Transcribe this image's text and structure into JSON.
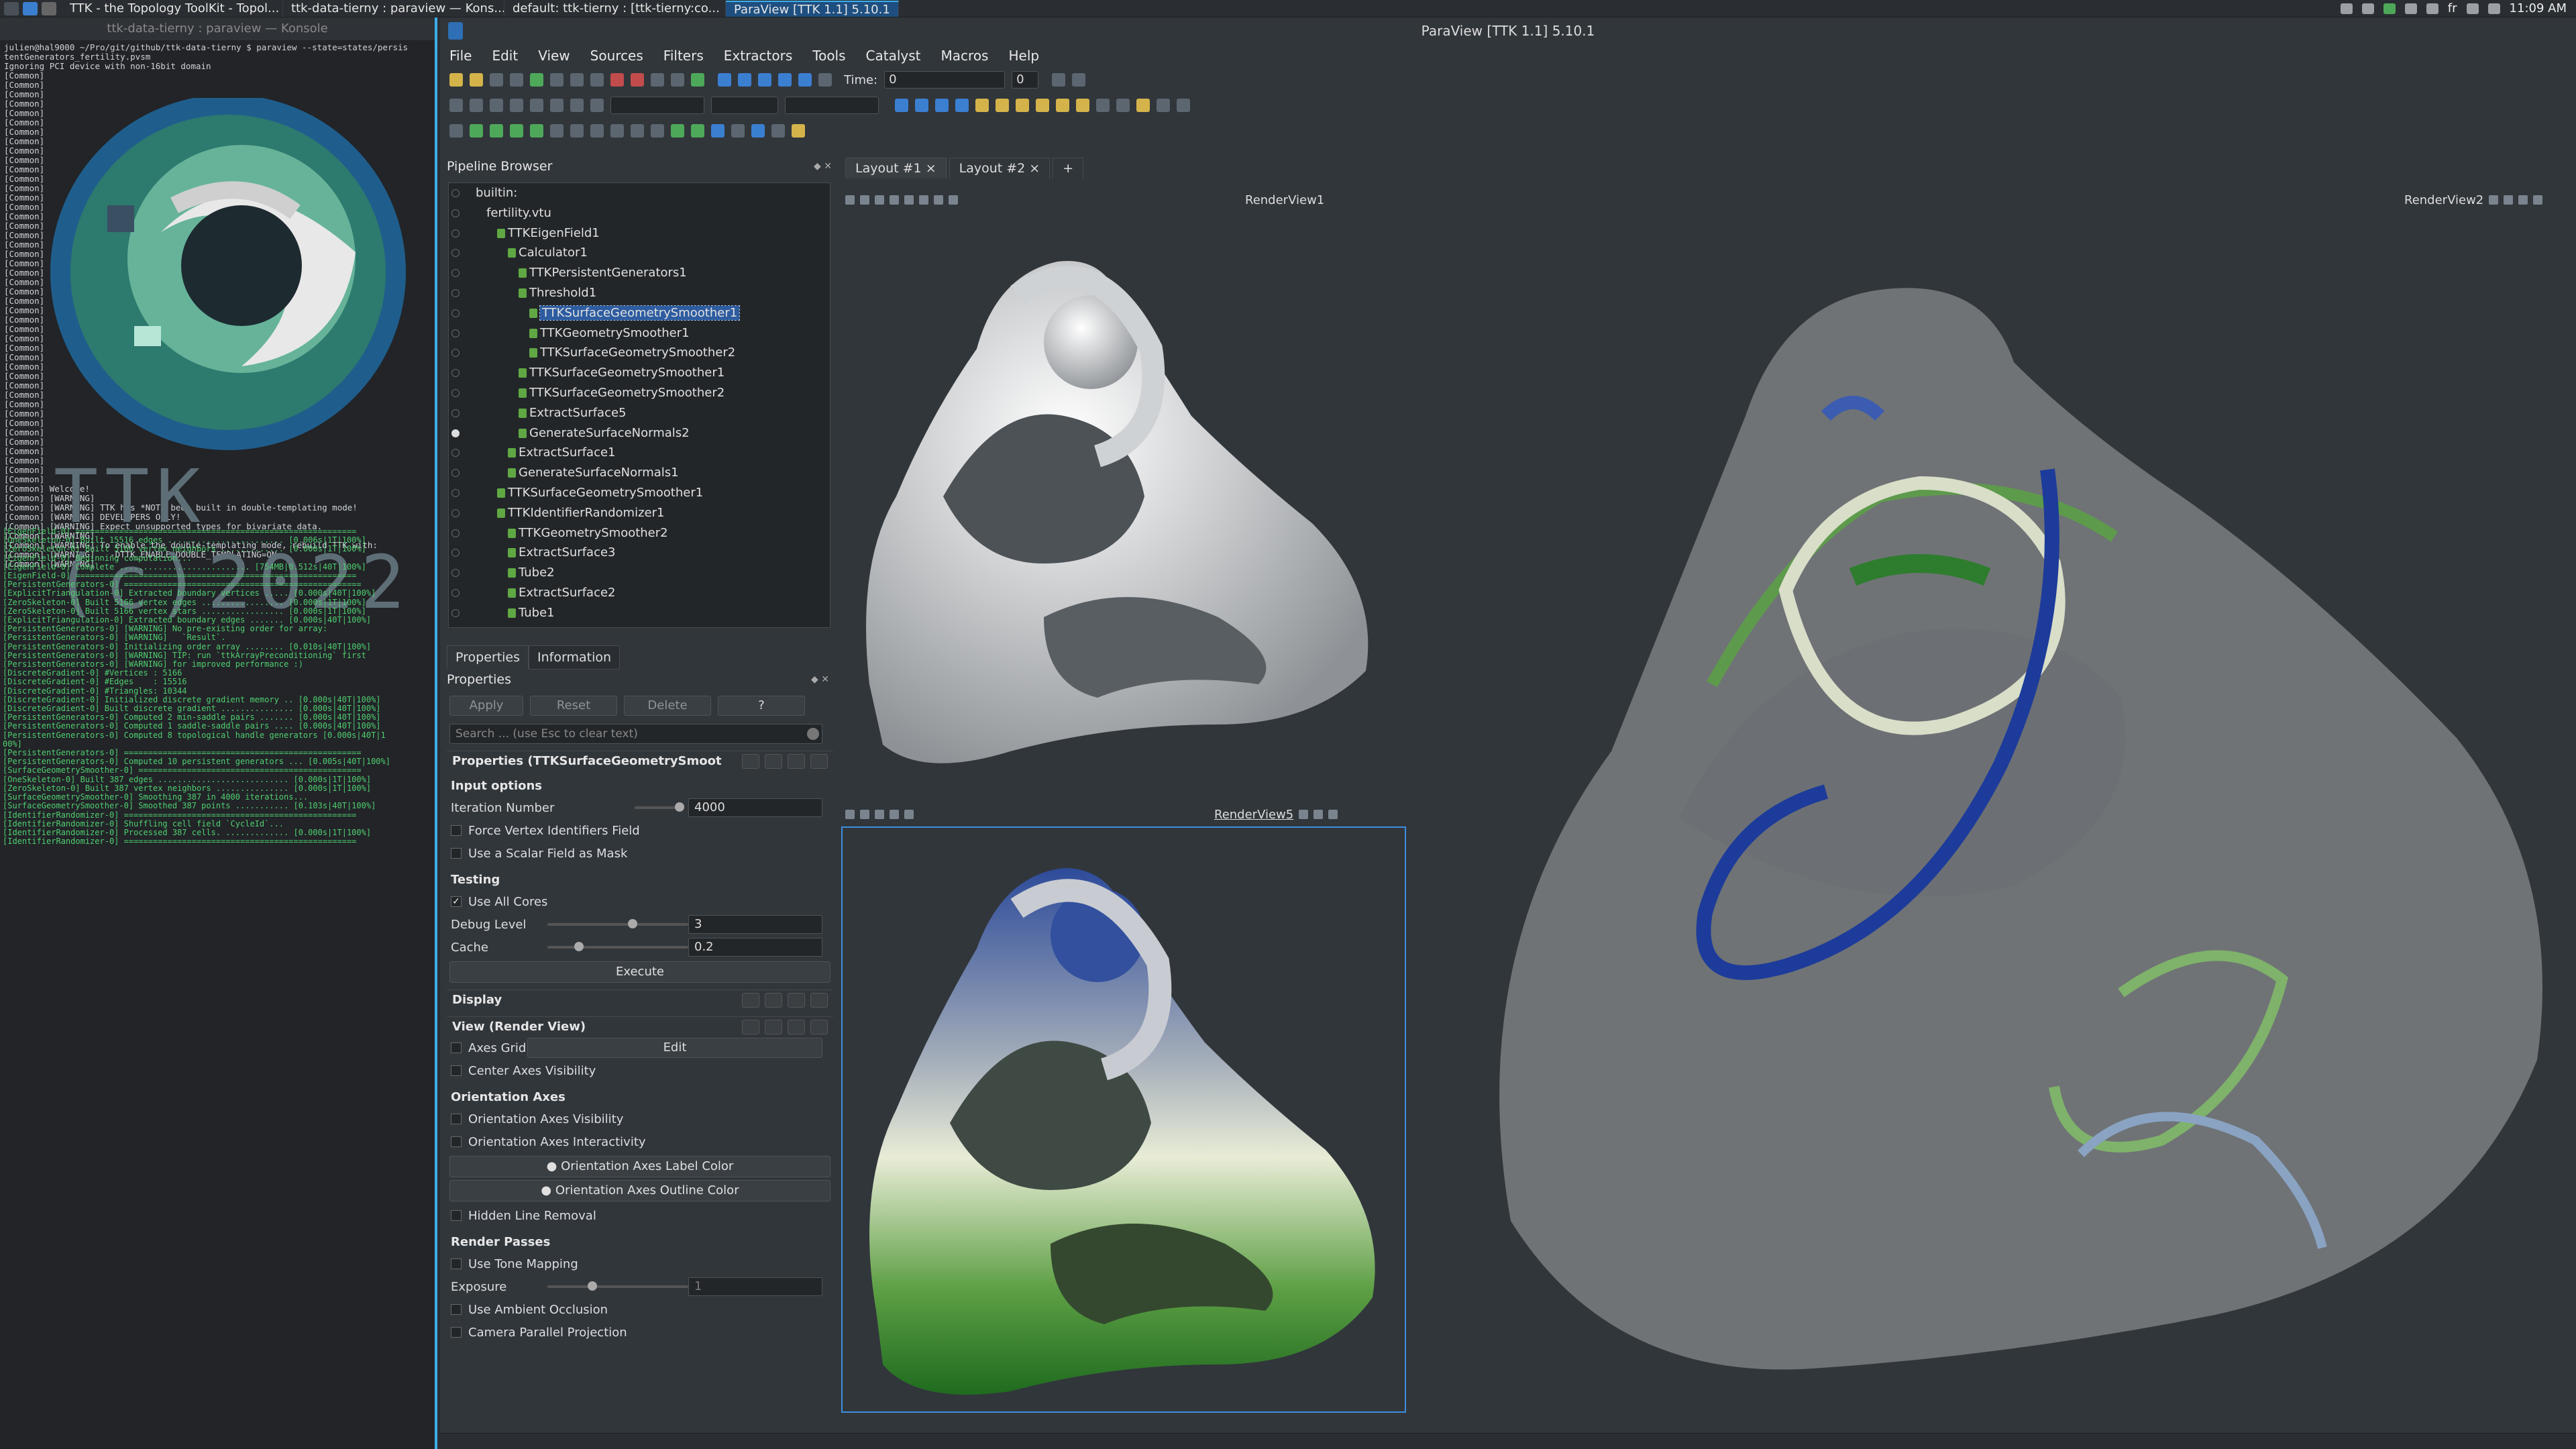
{
  "taskbar": {
    "tasks": [
      "TTK - the Topology ToolKit - Topol...",
      "ttk-data-tierny : paraview — Kons...",
      "default: ttk-tierny : [ttk-tierny:co...",
      "ParaView [TTK 1.1] 5.10.1"
    ],
    "clock": "11:09 AM"
  },
  "konsole": {
    "title": "ttk-data-tierny : paraview — Konsole",
    "cmd": "julien@hal9000 ~/Pro/git/github/ttk-data-tierny $ paraview --state=states/persis\ntentGenerators_fertility.pvsm\nIgnoring PCI device with non-16bit domain\n[Common]\n[Common]\n[Common]\n[Common]\n[Common]\n[Common]\n[Common]\n[Common]\n[Common]\n[Common]\n[Common]\n[Common]\n[Common]\n[Common]\n[Common]\n[Common]\n[Common]\n[Common]\n[Common]\n[Common]\n[Common]\n[Common]\n[Common]\n[Common]\n[Common]\n[Common]\n[Common]\n[Common]\n[Common]\n[Common]\n[Common]\n[Common]\n[Common]\n[Common]\n[Common]\n[Common]\n[Common]\n[Common]\n[Common]\n[Common]\n[Common]\n[Common]\n[Common]\n[Common]\n[Common] Welcome!\n[Common] [WARNING]\n[Common] [WARNING] TTK has *NOT* been built in double-templating mode!\n[Common] [WARNING] DEVELOPERS ONLY!\n[Common] [WARNING] Expect unsupported types for bivariate data.\n[Common] [WARNING]\n[Common] [WARNING] To enable the double-templating mode, rebuild TTK with:\n[Common] [WARNING]   -DTTK_ENABLE_DOUBLE_TEMPLATING=ON\n[Common] [WARNING]",
    "log": "[EigenField-0] ==========================================================\n[OneSkeleton-0] Built 15516 edges ........................ [0.006s|1T|100%]\n[ZeroSkeleton-0] Built 5166 vertex neighbors ............. [0.000s|1T|100%]\n[EigenField-0] Beginning computation...\n[EigenField-0] Complete ........................... [754MB|0.512s|40T|100%]\n[EigenField-0] ==========================================================\n[PersistentGenerators-0] =================================================\n[ExplicitTriangulation-0] Extracted boundary vertices ..... [0.000s|40T|100%]\n[ZeroSkeleton-0] Built 5166 vertex edges ................. [0.000s|1T|100%]\n[ZeroSkeleton-0] Built 5166 vertex stars ................. [0.000s|1T|100%]\n[ExplicitTriangulation-0] Extracted boundary edges ....... [0.000s|40T|100%]\n[PersistentGenerators-0] [WARNING] No pre-existing order for array:\n[PersistentGenerators-0] [WARNING]   `Result`.\n[PersistentGenerators-0] Initializing order array ........ [0.010s|40T|100%]\n[PersistentGenerators-0] [WARNING] TIP: run `ttkArrayPreconditioning` first\n[PersistentGenerators-0] [WARNING] for improved performance :)\n[DiscreteGradient-0] #Vertices : 5166\n[DiscreteGradient-0] #Edges    : 15516\n[DiscreteGradient-0] #Triangles: 10344\n[DiscreteGradient-0] Initialized discrete gradient memory .. [0.000s|40T|100%]\n[DiscreteGradient-0] Built discrete gradient ............... [0.000s|40T|100%]\n[PersistentGenerators-0] Computed 2 min-saddle pairs ....... [0.000s|40T|100%]\n[PersistentGenerators-0] Computed 1 saddle-saddle pairs .... [0.000s|40T|100%]\n[PersistentGenerators-0] Computed 8 topological handle generators [0.000s|40T|1\n00%]\n[PersistentGenerators-0] =================================================\n[PersistentGenerators-0] Computed 10 persistent generators ... [0.005s|40T|100%]\n[SurfaceGeometrySmoother-0] ==============================================\n[OneSkeleton-0] Built 387 edges ........................... [0.000s|1T|100%]\n[ZeroSkeleton-0] Built 387 vertex neighbors ............... [0.000s|1T|100%]\n[SurfaceGeometrySmoother-0] Smoothing 387 in 4000 iterations...\n[SurfaceGeometrySmoother-0] Smoothed 387 points ........... [0.103s|40T|100%]\n[IdentifierRandomizer-0] ================================================\n[IdentifierRandomizer-0] Shuffling cell field `CycleId`...\n[IdentifierRandomizer-0] Processed 387 cells. ............. [0.000s|1T|100%]\n[IdentifierRandomizer-0] ================================================",
    "art_text": "TTK    (c)2022"
  },
  "app": {
    "title": "ParaView [TTK 1.1] 5.10.1",
    "menu": [
      "File",
      "Edit",
      "View",
      "Sources",
      "Filters",
      "Extractors",
      "Tools",
      "Catalyst",
      "Macros",
      "Help"
    ],
    "time_label": "Time:",
    "time_value": "0",
    "time_index": "0"
  },
  "pipeline": {
    "title": "Pipeline Browser",
    "items": [
      {
        "label": "builtin:",
        "indent": 0,
        "eye": false,
        "icon": false
      },
      {
        "label": "fertility.vtu",
        "indent": 1,
        "eye": false,
        "icon": false
      },
      {
        "label": "TTKEigenField1",
        "indent": 2,
        "eye": false,
        "icon": true
      },
      {
        "label": "Calculator1",
        "indent": 3,
        "eye": false,
        "icon": true
      },
      {
        "label": "TTKPersistentGenerators1",
        "indent": 4,
        "eye": false,
        "icon": true
      },
      {
        "label": "Threshold1",
        "indent": 4,
        "eye": false,
        "icon": true
      },
      {
        "label": "TTKSurfaceGeometrySmoother1",
        "indent": 5,
        "eye": false,
        "icon": true,
        "selected": true
      },
      {
        "label": "TTKGeometrySmoother1",
        "indent": 5,
        "eye": false,
        "icon": true
      },
      {
        "label": "TTKSurfaceGeometrySmoother2",
        "indent": 5,
        "eye": false,
        "icon": true
      },
      {
        "label": "TTKSurfaceGeometrySmoother1",
        "indent": 4,
        "eye": false,
        "icon": true
      },
      {
        "label": "TTKSurfaceGeometrySmoother2",
        "indent": 4,
        "eye": false,
        "icon": true
      },
      {
        "label": "ExtractSurface5",
        "indent": 4,
        "eye": false,
        "icon": true
      },
      {
        "label": "GenerateSurfaceNormals2",
        "indent": 4,
        "eye": true,
        "icon": true
      },
      {
        "label": "ExtractSurface1",
        "indent": 3,
        "eye": false,
        "icon": true
      },
      {
        "label": "GenerateSurfaceNormals1",
        "indent": 3,
        "eye": false,
        "icon": true
      },
      {
        "label": "TTKSurfaceGeometrySmoother1",
        "indent": 2,
        "eye": false,
        "icon": true
      },
      {
        "label": "TTKIdentifierRandomizer1",
        "indent": 2,
        "eye": false,
        "icon": true
      },
      {
        "label": "TTKGeometrySmoother2",
        "indent": 3,
        "eye": false,
        "icon": true
      },
      {
        "label": "ExtractSurface3",
        "indent": 3,
        "eye": false,
        "icon": true
      },
      {
        "label": "Tube2",
        "indent": 3,
        "eye": false,
        "icon": true
      },
      {
        "label": "ExtractSurface2",
        "indent": 3,
        "eye": false,
        "icon": true
      },
      {
        "label": "Tube1",
        "indent": 3,
        "eye": false,
        "icon": true
      }
    ]
  },
  "properties": {
    "tab_properties": "Properties",
    "tab_information": "Information",
    "header": "Properties",
    "apply": "Apply",
    "reset": "Reset",
    "delete": "Delete",
    "help": "?",
    "search_placeholder": "Search ... (use Esc to clear text)",
    "section_title": "Properties (TTKSurfaceGeometrySmoot",
    "input_options": "Input options",
    "iteration_label": "Iteration Number",
    "iteration_value": "4000",
    "force_vertex": "Force Vertex Identifiers Field",
    "scalar_mask": "Use a Scalar Field as Mask",
    "testing": "Testing",
    "use_all_cores": "Use All Cores",
    "debug_label": "Debug Level",
    "debug_value": "3",
    "cache_label": "Cache",
    "cache_value": "0.2",
    "execute": "Execute",
    "display": "Display",
    "view_section": "View (Render View)",
    "axes_grid": "Axes Grid",
    "edit": "Edit",
    "center_axes": "Center Axes Visibility",
    "orientation_axes": "Orientation Axes",
    "oa_visibility": "Orientation Axes Visibility",
    "oa_interactivity": "Orientation Axes Interactivity",
    "oa_label_color": "Orientation Axes Label Color",
    "oa_outline_color": "Orientation Axes Outline Color",
    "hidden_line": "Hidden Line Removal",
    "render_passes": "Render Passes",
    "tone_mapping": "Use Tone Mapping",
    "exposure_label": "Exposure",
    "exposure_value": "1",
    "ambient": "Use Ambient Occlusion",
    "camera_parallel": "Camera Parallel Projection"
  },
  "views": {
    "layout1": "Layout #1",
    "layout2": "Layout #2",
    "rv1": "RenderView1",
    "rv2": "RenderView2",
    "rv5": "RenderView5"
  }
}
